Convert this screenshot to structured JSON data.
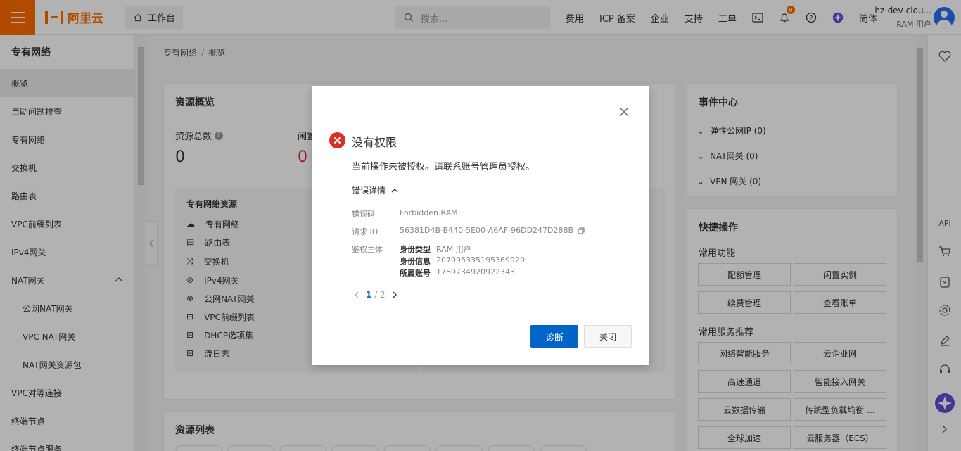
{
  "header": {
    "brand": "阿里云",
    "workbench_label": "工作台",
    "search_placeholder": "搜索...",
    "links": [
      "费用",
      "ICP 备案",
      "企业",
      "支持",
      "工单"
    ],
    "notification_count": "9",
    "language": "简体",
    "user_name": "hz-dev-clou...",
    "user_role": "RAM 用户"
  },
  "sidebar": {
    "title": "专有网络",
    "items": [
      {
        "label": "概览"
      },
      {
        "label": "自助问题排查"
      },
      {
        "label": "专有网络"
      },
      {
        "label": "交换机"
      },
      {
        "label": "路由表"
      },
      {
        "label": "VPC前缀列表"
      },
      {
        "label": "IPv4网关"
      },
      {
        "label": "NAT网关"
      },
      {
        "label": "公网NAT网关"
      },
      {
        "label": "VPC NAT网关"
      },
      {
        "label": "NAT网关资源包"
      },
      {
        "label": "VPC对等连接"
      },
      {
        "label": "终端节点"
      },
      {
        "label": "终端节点服务"
      }
    ]
  },
  "breadcrumb": {
    "root": "专有网络",
    "separator": "/",
    "current": "概览"
  },
  "resource_overview": {
    "title": "资源概览",
    "total_label": "资源总数",
    "total_value": "0",
    "idle_label": "闲置",
    "idle_value": "0",
    "vpc_box_title": "专有网络资源",
    "vpc_items": [
      "专有网络",
      "路由表",
      "交换机",
      "IPv4网关",
      "公网NAT网关",
      "VPC前缀列表",
      "DHCP选项集",
      "流日志"
    ]
  },
  "resource_list": {
    "title": "资源列表"
  },
  "event_center": {
    "title": "事件中心",
    "items": [
      "弹性公网IP (0)",
      "NAT网关 (0)",
      "VPN 网关 (0)"
    ]
  },
  "quick_ops": {
    "title": "快捷操作",
    "common_label": "常用功能",
    "common": [
      "配额管理",
      "闲置实例",
      "续费管理",
      "查看账单"
    ],
    "services_label": "常用服务推荐",
    "services": [
      "网络智能服务",
      "云企业网",
      "高速通道",
      "智能接入网关",
      "云数据传输",
      "传统型负载均衡 ...",
      "全球加速",
      "云服务器（ECS）"
    ]
  },
  "right_rail": {
    "api_label": "API"
  },
  "dialog": {
    "title": "没有权限",
    "message": "当前操作未被授权。请联系账号管理员授权。",
    "details_label": "错误详情",
    "error_code_label": "错误码",
    "error_code": "Forbidden.RAM",
    "request_id_label": "请求 ID",
    "request_id": "56381D4B-B440-5E00-A6AF-96DD247D288B",
    "auth_subject_label": "鉴权主体",
    "identity_type_label": "身份类型",
    "identity_type": "RAM 用户",
    "identity_info_label": "身份信息",
    "identity_info": "207095335195369920",
    "account_label": "所属账号",
    "account": "1789734920922343",
    "page_current": "1",
    "page_total": "/ 2",
    "primary_label": "诊断",
    "close_label": "关闭"
  }
}
